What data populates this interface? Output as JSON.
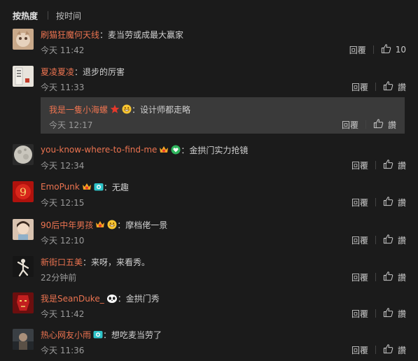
{
  "tabs": {
    "hot": "按热度",
    "time": "按时间"
  },
  "actions": {
    "reply": "回覆",
    "like": "讚"
  },
  "colors": {
    "username": "#eb7350",
    "background": "#1b1b1b",
    "sub_background": "#3a3a3a"
  },
  "comments": [
    {
      "user": "刷猫狂魔何天线",
      "text": "：麦当劳或成最大赢家",
      "time": "今天 11:42",
      "likes": "10"
    },
    {
      "user": "夏凌夏凌",
      "text": "：退步的厉害",
      "time": "今天 11:33",
      "sub": {
        "user": "我是一隻小海螺",
        "badges": [
          "star-badge-icon",
          "grin-emoji-icon"
        ],
        "text": "：设计师都走略",
        "time": "今天 12:17"
      }
    },
    {
      "user": "you-know-where-to-find-me",
      "badges": [
        "vip-crown-badge-icon",
        "green-heart-badge-icon"
      ],
      "text": "：金拱门实力抢镜",
      "time": "今天 12:34"
    },
    {
      "user": "EmoPunk",
      "badges": [
        "vip-crown-badge-icon",
        "camera-badge-icon"
      ],
      "text": "：无趣",
      "time": "今天 12:15"
    },
    {
      "user": "90后中年男孩",
      "badges": [
        "vip-crown-badge-icon",
        "grin-emoji-icon"
      ],
      "text": "：摩档佬一景",
      "time": "今天 12:10"
    },
    {
      "user": "新街口五美",
      "text": "：来呀，来看秀。",
      "time": "22分钟前"
    },
    {
      "user": "我是SeanDuke_",
      "badges": [
        "panda-badge-icon"
      ],
      "text": "：金拱门秀",
      "time": "今天 11:42"
    },
    {
      "user": "热心网友小雨",
      "badges": [
        "camera-badge-icon"
      ],
      "text": "：想吃麦当劳了",
      "time": "今天 11:36"
    }
  ]
}
